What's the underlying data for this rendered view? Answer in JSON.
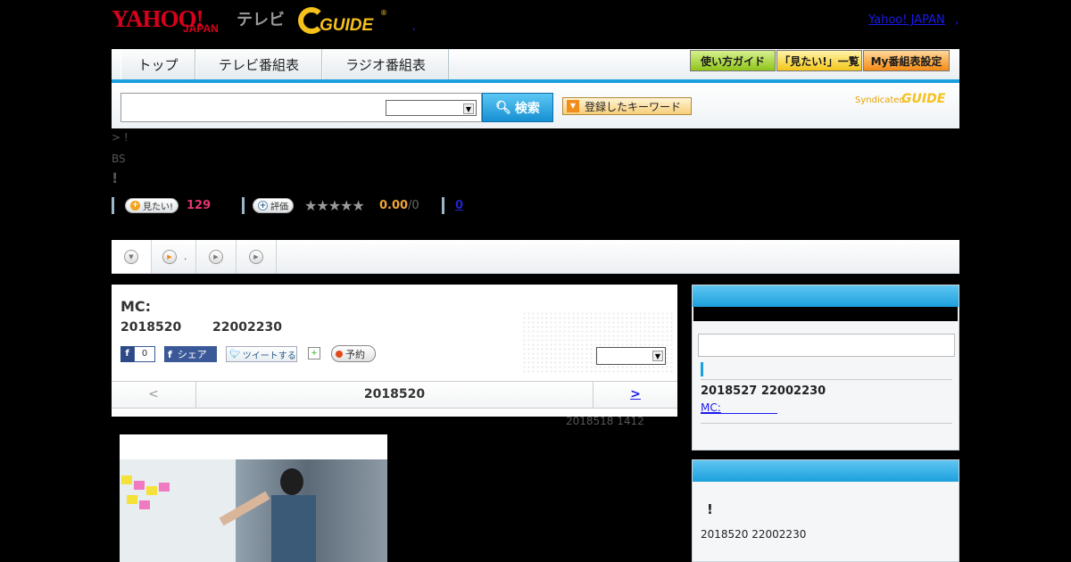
{
  "header": {
    "logo_yahoo": "YAHOO!",
    "logo_japan": "JAPAN",
    "logo_tv": "テレビ",
    "logo_gguide": "GUIDE",
    "logo_reg": "®",
    "dot": ",",
    "yahoo_japan_link": "Yahoo! JAPAN",
    "link_dot": ","
  },
  "nav": {
    "tabs": [
      {
        "label": "トップ"
      },
      {
        "label": "テレビ番組表"
      },
      {
        "label": "ラジオ番組表"
      }
    ],
    "guide_buttons": [
      {
        "label": "使い方ガイド"
      },
      {
        "label": "「見たい!」一覧"
      },
      {
        "label": "My番組表設定"
      }
    ]
  },
  "search": {
    "input_value": "",
    "select_value": "",
    "button_label": "検索",
    "keyword_button_label": "登録したキーワード",
    "syndicated_label": "Syndicated",
    "syndicated_logo": "GUIDE"
  },
  "program_meta": {
    "breadcrumb": "> !",
    "channel": "BS",
    "title": "!",
    "want_label": "見たい!",
    "want_count": "129",
    "rate_label": "評価",
    "stars": "★★★★★",
    "rating": "0.00",
    "rating_count": "/0",
    "review_count": "0"
  },
  "tabs_row": {
    "items": [
      {
        "label": ""
      },
      {
        "label": "."
      },
      {
        "label": ""
      },
      {
        "label": ""
      }
    ]
  },
  "program": {
    "title": "MC:",
    "date": "2018520",
    "time": "22002230",
    "fb_like_count": "0",
    "fb_share_label": "シェア",
    "tweet_label": "ツイートする",
    "reserve_label": "予約",
    "select_value": "",
    "pager_prev": "<",
    "pager_date": "2018520",
    "pager_next": ">",
    "updated": "2018518  1412"
  },
  "sidebar": {
    "box1": {
      "next_date": "2018527  22002230",
      "next_link": "MC:"
    },
    "box2": {
      "excl": "!",
      "date": "2018520  22002230"
    }
  },
  "colors": {
    "accent_blue": "#1ca0dd",
    "yahoo_red": "#d8001c",
    "gguide_yellow": "#f6c11a",
    "pink": "#e6336e"
  }
}
